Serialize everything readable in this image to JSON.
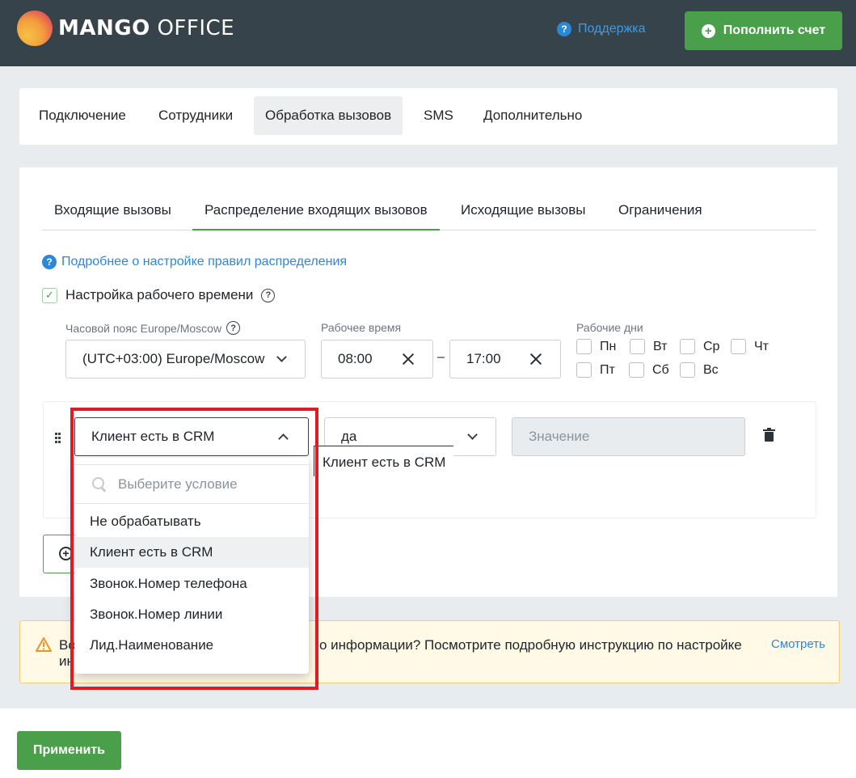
{
  "header": {
    "logo_bold": "MANGO",
    "logo_light": "OFFICE",
    "support_label": "Поддержка",
    "topup_label": "Пополнить счет"
  },
  "main_tabs": [
    {
      "label": "Подключение"
    },
    {
      "label": "Сотрудники"
    },
    {
      "label": "Обработка вызовов",
      "active": true
    },
    {
      "label": "SMS"
    },
    {
      "label": "Дополнительно"
    }
  ],
  "sub_tabs": [
    {
      "label": "Входящие вызовы"
    },
    {
      "label": "Распределение входящих вызовов",
      "active": true
    },
    {
      "label": "Исходящие вызовы"
    },
    {
      "label": "Ограничения"
    }
  ],
  "more_link": "Подробнее о настройке правил распределения",
  "work_time": {
    "checkbox_label": "Настройка рабочего времени",
    "checked": true,
    "timezone_label": "Часовой пояс Europe/Moscow",
    "timezone_value": "(UTC+03:00) Europe/Moscow",
    "time_label": "Рабочее время",
    "time_from": "08:00",
    "time_sep": "–",
    "time_to": "17:00",
    "days_label": "Рабочие дни",
    "days": [
      "Пн",
      "Вт",
      "Ср",
      "Чт",
      "Пт",
      "Сб",
      "Вс"
    ]
  },
  "rule": {
    "condition_value": "Клиент есть в CRM",
    "operand_value": "да",
    "value_placeholder": "Значение",
    "tooltip": "Клиент есть в CRM"
  },
  "dropdown": {
    "search_placeholder": "Выберите условие",
    "items": [
      {
        "label": "Не обрабатывать"
      },
      {
        "label": "Клиент есть в CRM",
        "highlighted": true
      },
      {
        "label": "Звонок.Номер телефона"
      },
      {
        "label": "Звонок.Номер линии"
      },
      {
        "label": "Лид.Наименование"
      }
    ]
  },
  "warning": {
    "text_start": "Во",
    "text_end": "о информации? Посмотрите подробную инструкцию по настройке",
    "text_line2": "ин",
    "link": "Смотреть"
  },
  "footer": {
    "apply_label": "Применить"
  },
  "colors": {
    "header_bg": "#37434b",
    "brand_green": "#4aa04a",
    "link_blue": "#2b88d8",
    "highlight_red": "#e01b24"
  }
}
